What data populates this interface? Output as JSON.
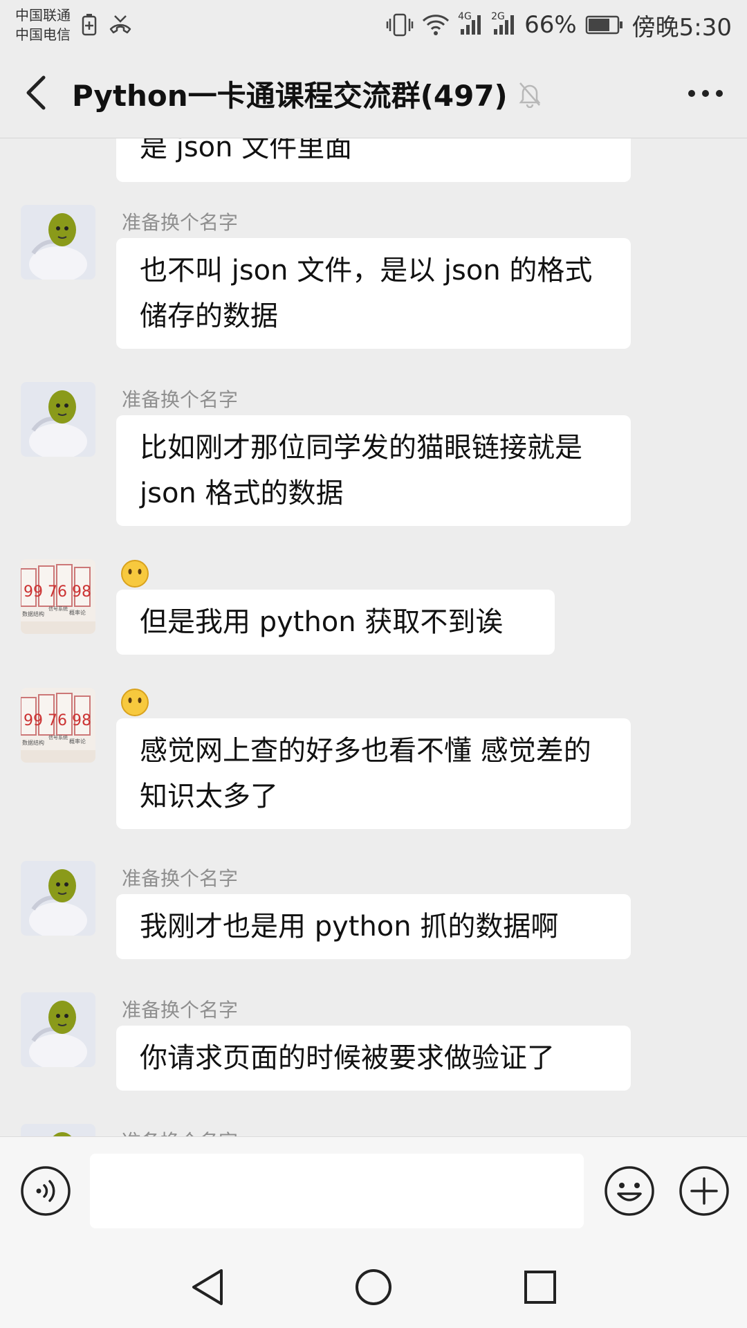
{
  "status_bar": {
    "carrier_1": "中国联通",
    "carrier_2": "中国电信",
    "net_1": "4G",
    "net_2": "2G",
    "battery": "66%",
    "time": "傍晚5:30"
  },
  "header": {
    "title": "Python一卡通课程交流群(497)"
  },
  "messages": [
    {
      "sender": "",
      "text": "是 json 文件里面"
    },
    {
      "sender": "准备换个名字",
      "text": "也不叫 json 文件，是以 json 的格式储存的数据"
    },
    {
      "sender": "准备换个名字",
      "text": "比如刚才那位同学发的猫眼链接就是 json 格式的数据"
    },
    {
      "sender": "",
      "text": "但是我用 python 获取不到诶"
    },
    {
      "sender": "",
      "text": "感觉网上查的好多也看不懂 感觉差的知识太多了"
    },
    {
      "sender": "准备换个名字",
      "text": "我刚才也是用 python 抓的数据啊"
    },
    {
      "sender": "准备换个名字",
      "text": "你请求页面的时候被要求做验证了"
    },
    {
      "sender": "准备换个名字",
      "text": ""
    }
  ],
  "avatar_labels": {
    "numbers": "99 76 98",
    "sub_1": "数据结构",
    "sub_2": "信号系统",
    "sub_3": "概率论"
  },
  "icons": {
    "back": "chevron-left-icon",
    "mute": "bell-off-icon",
    "more": "more-icon",
    "voice": "voice-icon",
    "emoji": "emoji-icon",
    "plus": "plus-icon"
  },
  "colors": {
    "background": "#ededed",
    "bubble": "#ffffff",
    "sender_name": "#8f8f8f"
  }
}
